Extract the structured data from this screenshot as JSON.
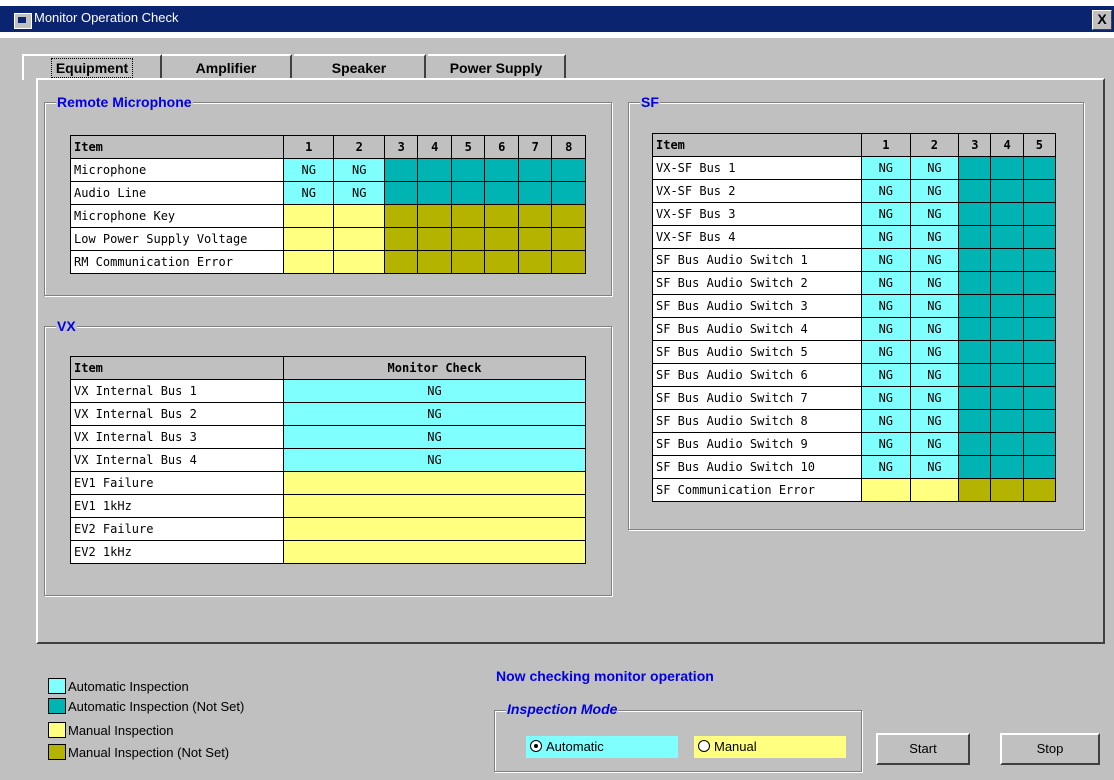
{
  "window": {
    "title": "Monitor Operation Check",
    "close": "X"
  },
  "tabs": [
    "Equipment",
    "Amplifier",
    "Speaker",
    "Power Supply"
  ],
  "remote_mic": {
    "title": "Remote Microphone",
    "headers": [
      "Item",
      "1",
      "2",
      "3",
      "4",
      "5",
      "6",
      "7",
      "8"
    ],
    "rows": [
      {
        "label": "Microphone",
        "c1": "NG",
        "c2": "NG"
      },
      {
        "label": "Audio Line",
        "c1": "NG",
        "c2": "NG"
      },
      {
        "label": "Microphone Key"
      },
      {
        "label": "Low Power Supply Voltage"
      },
      {
        "label": "RM Communication Error"
      }
    ]
  },
  "vx": {
    "title": "VX",
    "headers": [
      "Item",
      "Monitor Check"
    ],
    "rows": [
      {
        "label": "VX Internal Bus 1",
        "value": "NG"
      },
      {
        "label": "VX Internal Bus 2",
        "value": "NG"
      },
      {
        "label": "VX Internal Bus 3",
        "value": "NG"
      },
      {
        "label": "VX Internal Bus 4",
        "value": "NG"
      },
      {
        "label": "EV1 Failure"
      },
      {
        "label": "EV1 1kHz"
      },
      {
        "label": "EV2 Failure"
      },
      {
        "label": "EV2 1kHz"
      }
    ]
  },
  "sf": {
    "title": "SF",
    "headers": [
      "Item",
      "1",
      "2",
      "3",
      "4",
      "5"
    ],
    "rows": [
      {
        "label": "VX-SF Bus 1",
        "c1": "NG",
        "c2": "NG"
      },
      {
        "label": "VX-SF Bus 2",
        "c1": "NG",
        "c2": "NG"
      },
      {
        "label": "VX-SF Bus 3",
        "c1": "NG",
        "c2": "NG"
      },
      {
        "label": "VX-SF Bus 4",
        "c1": "NG",
        "c2": "NG"
      },
      {
        "label": "SF Bus Audio Switch 1",
        "c1": "NG",
        "c2": "NG"
      },
      {
        "label": "SF Bus Audio Switch 2",
        "c1": "NG",
        "c2": "NG"
      },
      {
        "label": "SF Bus Audio Switch 3",
        "c1": "NG",
        "c2": "NG"
      },
      {
        "label": "SF Bus Audio Switch 4",
        "c1": "NG",
        "c2": "NG"
      },
      {
        "label": "SF Bus Audio Switch 5",
        "c1": "NG",
        "c2": "NG"
      },
      {
        "label": "SF Bus Audio Switch 6",
        "c1": "NG",
        "c2": "NG"
      },
      {
        "label": "SF Bus Audio Switch 7",
        "c1": "NG",
        "c2": "NG"
      },
      {
        "label": "SF Bus Audio Switch 8",
        "c1": "NG",
        "c2": "NG"
      },
      {
        "label": "SF Bus Audio Switch 9",
        "c1": "NG",
        "c2": "NG"
      },
      {
        "label": "SF Bus Audio Switch 10",
        "c1": "NG",
        "c2": "NG"
      },
      {
        "label": "SF Communication Error"
      }
    ]
  },
  "legend": [
    {
      "label": "Automatic Inspection",
      "color": "#80ffff"
    },
    {
      "label": "Automatic Inspection (Not Set)",
      "color": "#00b4b4"
    },
    {
      "label": "Manual Inspection",
      "color": "#ffff80"
    },
    {
      "label": "Manual Inspection (Not Set)",
      "color": "#b4b400"
    }
  ],
  "status": "Now checking monitor operation",
  "inspection_mode": {
    "title": "Inspection Mode",
    "automatic": "Automatic",
    "manual": "Manual",
    "selected": "Automatic"
  },
  "buttons": {
    "start": "Start",
    "stop": "Stop"
  },
  "colors": {
    "auto": "#80ffff",
    "auto_not_set": "#00b4b4",
    "manual": "#ffff80",
    "manual_not_set": "#b4b400",
    "title_bar": "#0a2470",
    "group_title": "#0000e0"
  }
}
